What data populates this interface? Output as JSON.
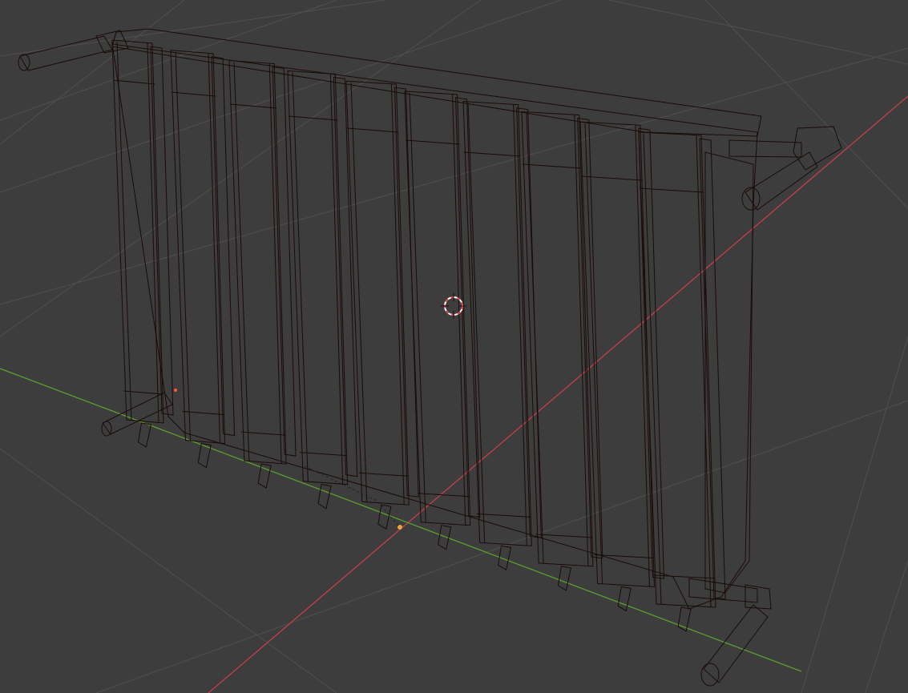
{
  "viewport": {
    "mode": "object-mode-solid-wireframe-overlay",
    "background_color": "#3d3d3d",
    "grid_color": "#4f4f4f",
    "x_axis_color": "#c0404a",
    "y_axis_color": "#5aa02c"
  },
  "object": {
    "type": "radiator",
    "section_count": 10,
    "base_color": "#8a3c30",
    "highlight_color": "#b66050",
    "shadow_color": "#5e261d",
    "edge_color": "#1a0b08"
  },
  "cursor_3d": {
    "icon": "3d-cursor-icon",
    "ring_colors": [
      "#e04040",
      "#ffffff"
    ]
  },
  "origin_point_color": "#e6a83a"
}
